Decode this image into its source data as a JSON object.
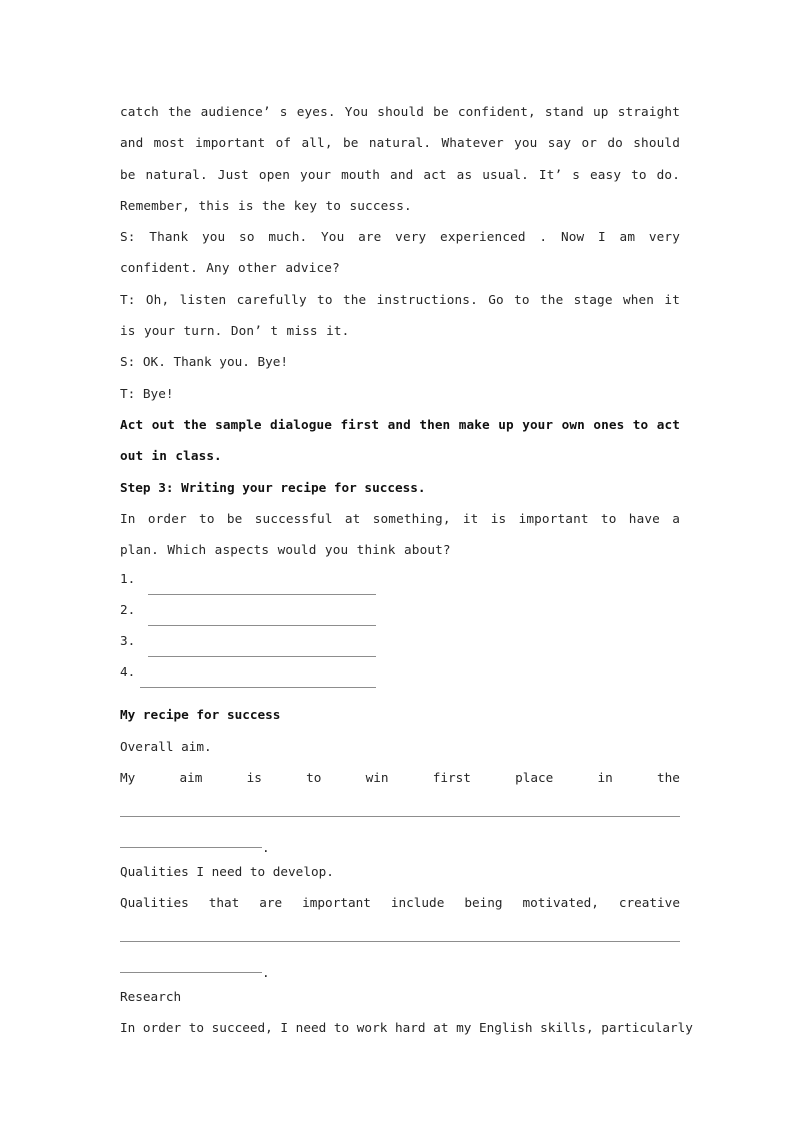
{
  "document": {
    "paragraphs": {
      "teacher_advice": "catch the audience’ s eyes. You should be confident, stand up straight and most important of all, be natural. Whatever you say or do should be natural. Just open your mouth and act as usual. It’ s easy to do. Remember, this is the key to success.",
      "student_thanks": "S: Thank you so much. You are very experienced . Now I am very confident. Any other advice?",
      "teacher_instructions": "T: Oh, listen carefully to the instructions. Go to the stage when it is your turn. Don’ t miss it.",
      "student_bye": "S: OK. Thank you. Bye!",
      "teacher_bye": "T: Bye!",
      "act_out_instruction": "Act out the sample dialogue first and then make up your own ones to act out in class.",
      "step3_heading": "Step 3: Writing your recipe for success.",
      "plan_intro": "In order to be successful at something, it is important to have a plan. Which aspects would you think about?",
      "recipe_heading": "My recipe for success",
      "overall_aim_label": "Overall aim.",
      "qualities_label": "Qualities I need to develop.",
      "research_label": "Research",
      "research_text": "In order to succeed, I need to work hard at my English skills, particularly"
    },
    "blank_items": [
      {
        "number": "1.",
        "style": "gap"
      },
      {
        "number": "2.",
        "style": "gap"
      },
      {
        "number": "3.",
        "style": "gap"
      },
      {
        "number": "4.",
        "style": "nogap"
      }
    ],
    "aim_sentence_words": [
      "My",
      "aim",
      "is",
      "to",
      "win",
      "first",
      "place",
      "in",
      "the"
    ],
    "qualities_sentence_words": [
      "Qualities",
      "that",
      "are",
      "important",
      "include",
      "being",
      "motivated,",
      "creative"
    ],
    "terminator": ".",
    "colors": {
      "page_background": "#ffffff",
      "body_text": "#262626",
      "heading_text": "#111111",
      "rule": "#8d8d8d"
    }
  }
}
